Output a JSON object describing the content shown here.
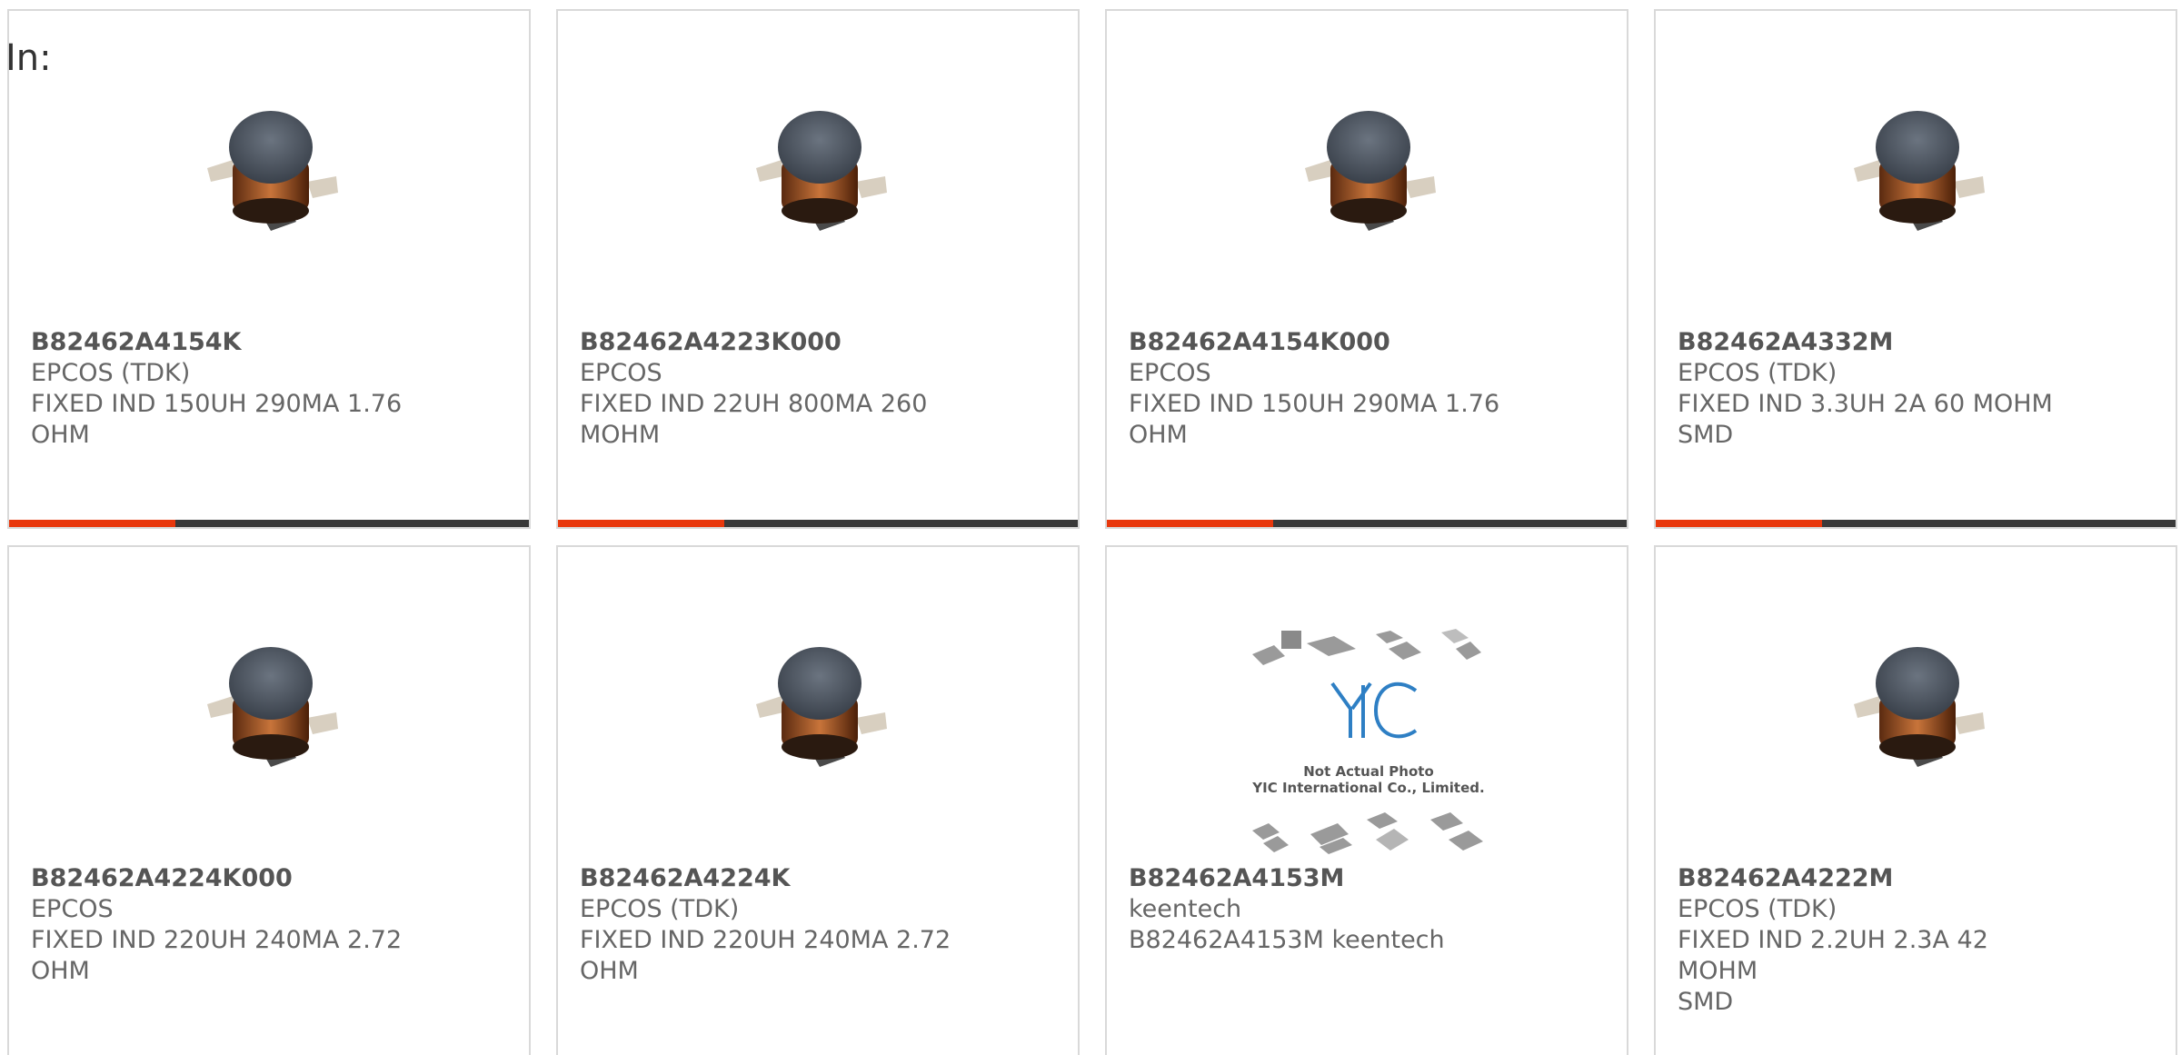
{
  "header": {
    "label": "In:"
  },
  "products": [
    {
      "part": "B82462A4154K",
      "maker": "EPCOS (TDK)",
      "desc1": "FIXED IND 150UH 290MA 1.76",
      "desc2": "OHM",
      "image": "inductor-image",
      "progress": 0.32
    },
    {
      "part": "B82462A4223K000",
      "maker": "EPCOS",
      "desc1": "FIXED IND 22UH 800MA 260",
      "desc2": "MOHM",
      "image": "inductor-image",
      "progress": 0.32
    },
    {
      "part": "B82462A4154K000",
      "maker": "EPCOS",
      "desc1": "FIXED IND 150UH 290MA 1.76",
      "desc2": "OHM",
      "image": "inductor-image",
      "progress": 0.32
    },
    {
      "part": "B82462A4332M",
      "maker": "EPCOS (TDK)",
      "desc1": "FIXED IND 3.3UH 2A 60 MOHM",
      "desc2": "SMD",
      "image": "inductor-image",
      "progress": 0.32
    },
    {
      "part": "B82462A4224K000",
      "maker": "EPCOS",
      "desc1": "FIXED IND 220UH 240MA 2.72",
      "desc2": "OHM",
      "image": "inductor-image"
    },
    {
      "part": "B82462A4224K",
      "maker": "EPCOS (TDK)",
      "desc1": "FIXED IND 220UH 240MA 2.72",
      "desc2": "OHM",
      "image": "inductor-image"
    },
    {
      "part": "B82462A4153M",
      "maker": "keentech",
      "desc1": "B82462A4153M keentech",
      "desc2": "",
      "image": "placeholder-image",
      "placeholder_line1": "Not Actual Photo",
      "placeholder_line2": "YIC International Co., Limited."
    },
    {
      "part": "B82462A4222M",
      "maker": "EPCOS (TDK)",
      "desc1": "FIXED IND 2.2UH 2.3A 42 MOHM",
      "desc2": "SMD",
      "image": "inductor-image"
    }
  ],
  "colors": {
    "accent": "#e8380d",
    "track": "#3a3a3a",
    "border": "#d9d9d9",
    "text": "#666666"
  }
}
